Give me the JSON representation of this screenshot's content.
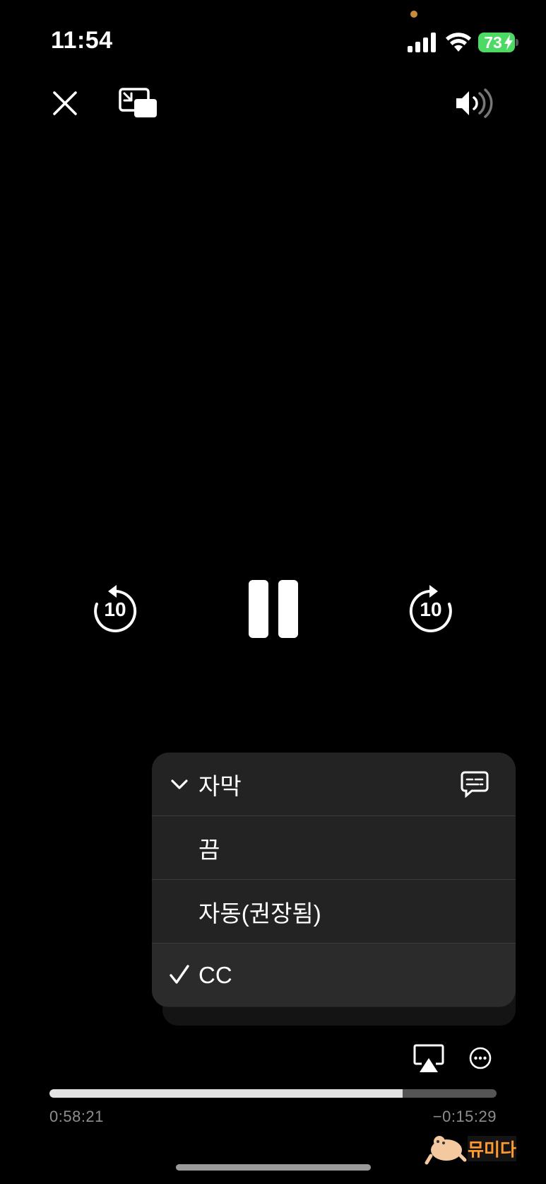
{
  "status_bar": {
    "time": "11:54",
    "battery_level": "73",
    "battery_color": "#4cd964"
  },
  "top_controls": {
    "close_icon": "xmark-icon",
    "pip_icon": "picture-in-picture-icon",
    "volume_icon": "speaker-wave-icon"
  },
  "playback": {
    "skip_back_seconds": "10",
    "skip_forward_seconds": "10",
    "state_icon": "pause-icon",
    "elapsed": "0:58:21",
    "remaining": "−0:15:29",
    "progress": 0.79
  },
  "subtitles_menu": {
    "title": "자막",
    "options": [
      {
        "label": "끔",
        "selected": false
      },
      {
        "label": "자동(권장됨)",
        "selected": false
      },
      {
        "label": "CC",
        "selected": true
      }
    ]
  },
  "bottom_controls": {
    "airplay_icon": "airplay-icon",
    "more_icon": "ellipsis-circle-icon"
  },
  "watermark": {
    "text": "뮤미다"
  }
}
